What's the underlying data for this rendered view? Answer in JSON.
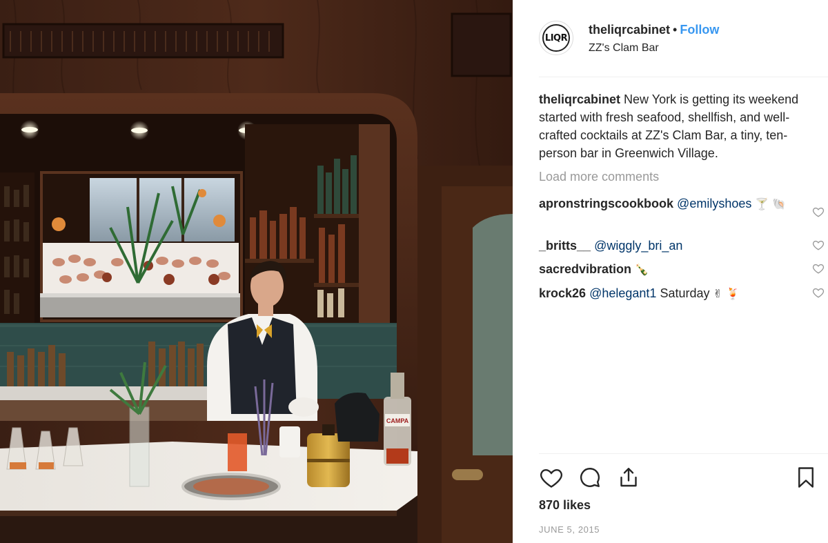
{
  "post": {
    "image_alt": "Bartender at ZZ's Clam Bar",
    "bottle_label": "CAMPA"
  },
  "header": {
    "avatar_text": "LIQR",
    "username": "theliqrcabinet",
    "separator": "•",
    "follow_label": "Follow",
    "location": "ZZ's Clam Bar"
  },
  "caption": {
    "username": "theliqrcabinet",
    "text": "New York is getting its weekend started with fresh seafood, shellfish, and well-crafted cocktails at ZZ's Clam Bar, a tiny, ten-person bar in Greenwich Village."
  },
  "load_more": "Load more comments",
  "comments": [
    {
      "username": "apronstringscookbook",
      "mention": "@emilyshoes",
      "text": "",
      "emoji": "🍸 🐚"
    },
    {
      "username": "_britts__",
      "mention": "@wiggly_bri_an",
      "text": "",
      "emoji": ""
    },
    {
      "username": "sacredvibration",
      "mention": "",
      "text": "",
      "emoji": "🍾"
    },
    {
      "username": "krock26",
      "mention": "@helegant1",
      "text": "Saturday",
      "emoji": "✌ 🍹"
    }
  ],
  "actions": {
    "like_icon": "heart-icon",
    "comment_icon": "comment-icon",
    "share_icon": "share-icon",
    "save_icon": "bookmark-icon"
  },
  "likes": "870 likes",
  "date": "JUNE 5, 2015",
  "colors": {
    "follow": "#3897f0",
    "mention": "#003569",
    "muted": "#999999"
  }
}
